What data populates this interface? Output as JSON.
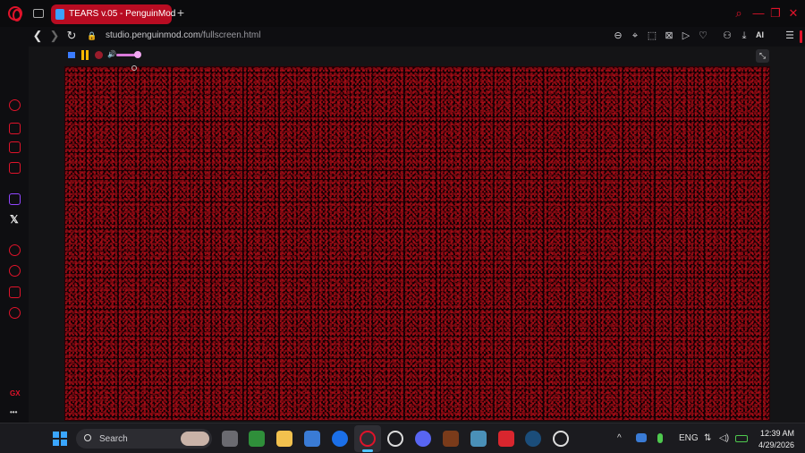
{
  "browser": {
    "tab_title": "TEARS v.05 - PenguinMod",
    "new_tab_label": "+",
    "url_host": "studio.penguinmod.com",
    "url_path": "/fullscreen.html",
    "ai_label": "AI"
  },
  "window": {
    "minimize": "—",
    "maximize": "❐",
    "close": "✕",
    "search": "⌕"
  },
  "nav": {
    "back": "❮",
    "forward": "❯",
    "reload": "↻",
    "lock": "🔒"
  },
  "sidebar": {
    "gx_label": "GX",
    "more_label": "•••",
    "twitter_label": "𝕏"
  },
  "project": {
    "volume_icon": "🔊",
    "fullscreen_icon": "⤡"
  },
  "taskbar": {
    "search_label": "Search",
    "language": "ENG",
    "time": "12:39 AM",
    "date": "4/29/2026",
    "tray_chevron": "^"
  },
  "colors": {
    "accent": "#e0132a",
    "tab_active": "#b80c22",
    "stage_noise": "#8a0a12"
  }
}
